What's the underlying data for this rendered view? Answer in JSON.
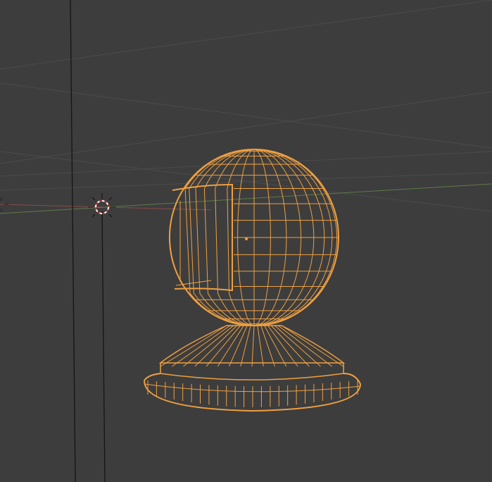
{
  "viewport": {
    "mode": "wireframe",
    "background_color": "#3d3d3d",
    "grid_color": "#4a4a4a",
    "x_axis_color": "#8a4a4a",
    "y_axis_color": "#5f7a4a",
    "selection_color": "#f0a040",
    "origin_color": "#f0a040"
  },
  "scene_objects": [
    {
      "name": "sphere-pedestal",
      "selected": true
    },
    {
      "name": "3d-cursor"
    },
    {
      "name": "camera-lines"
    }
  ]
}
